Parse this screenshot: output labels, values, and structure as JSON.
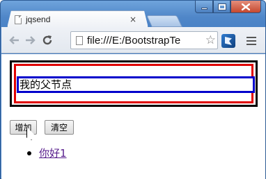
{
  "window": {
    "tab_title": "jqsend",
    "tab_close": "×",
    "colors": {
      "frame": "#4f86c8",
      "close_button": "#c5482e"
    }
  },
  "toolbar": {
    "back_icon": "arrow-left-icon",
    "forward_icon": "arrow-right-icon",
    "reload_icon": "reload-icon",
    "url": "file:///E:/BootstrapTe",
    "bookmark_icon": "star-icon",
    "menu_icon": "hamburger-menu-icon"
  },
  "content": {
    "parent_label": "我的父节点",
    "buttons": {
      "add": "增加",
      "clear": "清空"
    },
    "list_items": [
      "你好1"
    ],
    "colors": {
      "outer_border": "#000000",
      "middle_border": "#e00000",
      "inner_border": "#0000cc",
      "link": "#551a8b"
    }
  }
}
